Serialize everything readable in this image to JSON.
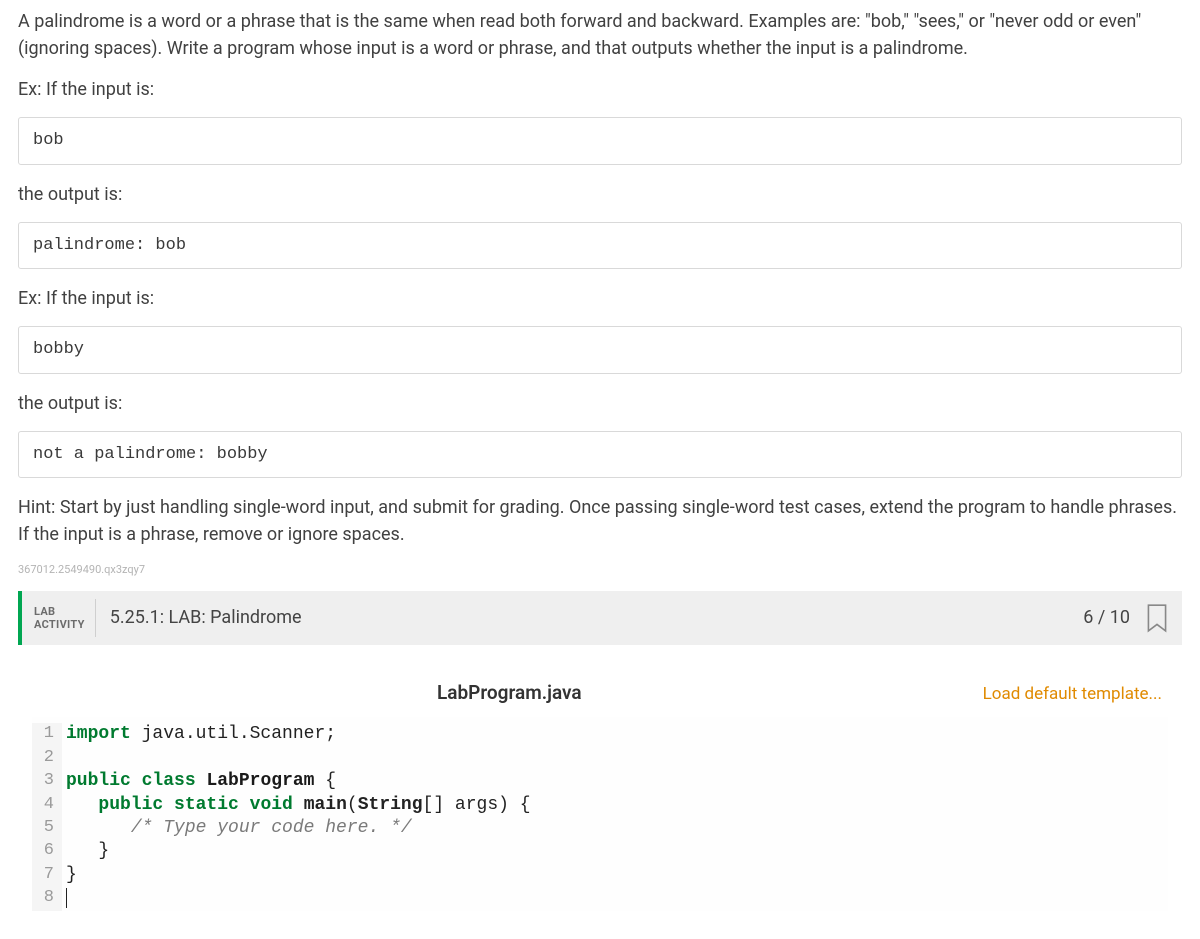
{
  "desc": {
    "intro": "A palindrome is a word or a phrase that is the same when read both forward and backward. Examples are: \"bob,\" \"sees,\" or \"never odd or even\" (ignoring spaces). Write a program whose input is a word or phrase, and that outputs whether the input is a palindrome.",
    "ex1_label": "Ex: If the input is:",
    "ex1_input": "bob",
    "out1_label": "the output is:",
    "ex1_output": "palindrome: bob",
    "ex2_label": "Ex: If the input is:",
    "ex2_input": "bobby",
    "out2_label": "the output is:",
    "ex2_output": "not a palindrome: bobby",
    "hint": "Hint: Start by just handling single-word input, and submit for grading. Once passing single-word test cases, extend the program to handle phrases. If the input is a phrase, remove or ignore spaces.",
    "footer_id": "367012.2549490.qx3zqy7"
  },
  "lab": {
    "badge_line1": "LAB",
    "badge_line2": "ACTIVITY",
    "title": "5.25.1: LAB: Palindrome",
    "score": "6 / 10"
  },
  "editor": {
    "filename": "LabProgram.java",
    "load_template_label": "Load default template...",
    "lines": [
      {
        "n": "1",
        "tokens": [
          [
            "kw",
            "import"
          ],
          [
            "plain",
            " java.util.Scanner;"
          ]
        ]
      },
      {
        "n": "2",
        "tokens": []
      },
      {
        "n": "3",
        "tokens": [
          [
            "kw",
            "public"
          ],
          [
            "plain",
            " "
          ],
          [
            "kw",
            "class"
          ],
          [
            "plain",
            " "
          ],
          [
            "class",
            "LabProgram"
          ],
          [
            "plain",
            " {"
          ]
        ]
      },
      {
        "n": "4",
        "tokens": [
          [
            "plain",
            "   "
          ],
          [
            "kw",
            "public"
          ],
          [
            "plain",
            " "
          ],
          [
            "kw",
            "static"
          ],
          [
            "plain",
            " "
          ],
          [
            "kw",
            "void"
          ],
          [
            "plain",
            " "
          ],
          [
            "func",
            "main"
          ],
          [
            "plain",
            "("
          ],
          [
            "type",
            "String"
          ],
          [
            "plain",
            "[] args) {"
          ]
        ]
      },
      {
        "n": "5",
        "tokens": [
          [
            "plain",
            "      "
          ],
          [
            "comment",
            "/* Type your code here. */"
          ]
        ]
      },
      {
        "n": "6",
        "tokens": [
          [
            "plain",
            "   }"
          ]
        ]
      },
      {
        "n": "7",
        "tokens": [
          [
            "plain",
            "}"
          ]
        ]
      },
      {
        "n": "8",
        "tokens": [
          [
            "cursor",
            ""
          ]
        ]
      }
    ]
  }
}
